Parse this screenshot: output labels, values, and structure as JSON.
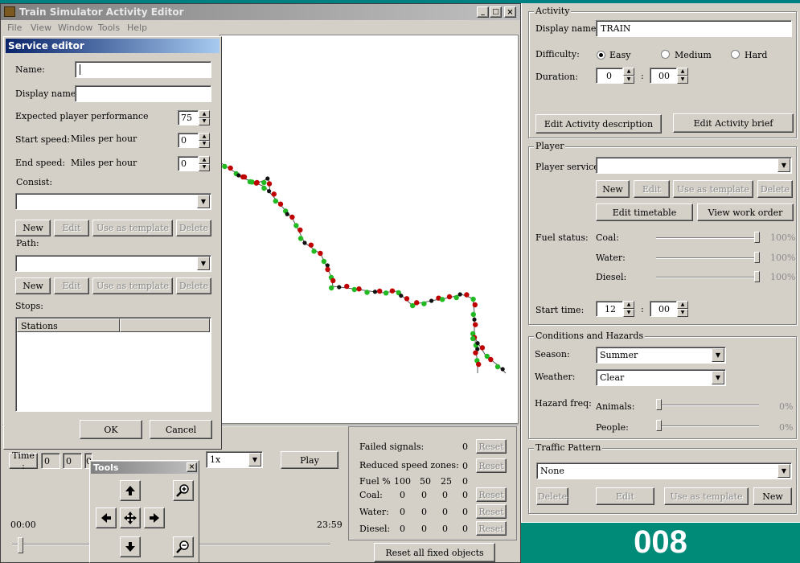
{
  "app": {
    "title": "Train Simulator Activity Editor",
    "menu": [
      "File",
      "View",
      "Window",
      "Tools",
      "Help"
    ]
  },
  "service_editor": {
    "title": "Service editor",
    "name_label": "Name:",
    "name_value": "",
    "display_name_label": "Display name:",
    "display_name_value": "",
    "performance_label": "Expected player performance",
    "performance_value": "75",
    "start_speed_label": "Start speed:",
    "start_speed_unit": "Miles per hour",
    "start_speed_value": "0",
    "end_speed_label": "End speed:",
    "end_speed_unit": "Miles per hour",
    "end_speed_value": "0",
    "consist_label": "Consist:",
    "consist_value": "",
    "path_label": "Path:",
    "path_value": "",
    "btn_new": "New",
    "btn_edit": "Edit",
    "btn_template": "Use as template",
    "btn_delete": "Delete",
    "stops_label": "Stops:",
    "stations_header": "Stations",
    "ok": "OK",
    "cancel": "Cancel"
  },
  "activity": {
    "group": "Activity",
    "display_name_label": "Display name:",
    "display_name_value": "TRAIN",
    "difficulty_label": "Difficulty:",
    "difficulty_options": [
      "Easy",
      "Medium",
      "Hard"
    ],
    "difficulty_selected": "Easy",
    "duration_label": "Duration:",
    "duration_hours": "0",
    "duration_sep": ":",
    "duration_minutes": "00",
    "edit_description": "Edit Activity description",
    "edit_brief": "Edit Activity brief"
  },
  "player": {
    "group": "Player",
    "service_label": "Player service:",
    "service_value": "",
    "btn_new": "New",
    "btn_edit": "Edit",
    "btn_template": "Use as template",
    "btn_delete": "Delete",
    "edit_timetable": "Edit timetable",
    "view_work_order": "View work order",
    "fuel_status_label": "Fuel status:",
    "fuel": [
      {
        "label": "Coal:",
        "value": "100%",
        "level": 1.0
      },
      {
        "label": "Water:",
        "value": "100%",
        "level": 1.0
      },
      {
        "label": "Diesel:",
        "value": "100%",
        "level": 1.0
      }
    ],
    "start_time_label": "Start time:",
    "start_hours": "12",
    "start_sep": ":",
    "start_minutes": "00"
  },
  "conditions": {
    "group": "Conditions and Hazards",
    "season_label": "Season:",
    "season_value": "Summer",
    "weather_label": "Weather:",
    "weather_value": "Clear",
    "hazard_label": "Hazard freq:",
    "animals_label": "Animals:",
    "animals_value": "0%",
    "people_label": "People:",
    "people_value": "0%"
  },
  "traffic": {
    "group": "Traffic Pattern",
    "value": "None",
    "btn_delete": "Delete",
    "btn_edit": "Edit",
    "btn_template": "Use as template",
    "btn_new": "New"
  },
  "timeline": {
    "time_label": "Time :",
    "time_fields": [
      "0",
      "0",
      "0"
    ],
    "speed_value": "1x",
    "play": "Play",
    "start": "00:00",
    "end": "23:59"
  },
  "tools": {
    "title": "Tools"
  },
  "signals": {
    "failed_signals": "Failed signals:",
    "failed_value": "0",
    "reduced_speed": "Reduced speed zones:",
    "reduced_value": "0",
    "reset": "Reset",
    "fuel_header": [
      "Fuel %",
      "100",
      "50",
      "25",
      "0"
    ],
    "rows": [
      {
        "label": "Coal:",
        "values": [
          "0",
          "0",
          "0",
          "0"
        ]
      },
      {
        "label": "Water:",
        "values": [
          "0",
          "0",
          "0",
          "0"
        ]
      },
      {
        "label": "Diesel:",
        "values": [
          "0",
          "0",
          "0",
          "0"
        ]
      }
    ],
    "reset_all": "Reset all fixed objects"
  },
  "banner": "008",
  "colors": {
    "desktop": "#008080",
    "banner": "#008a78",
    "title_active": "#0a246a",
    "title_inactive": "#808080",
    "route_red": "#c00000",
    "route_green": "#22b922"
  }
}
